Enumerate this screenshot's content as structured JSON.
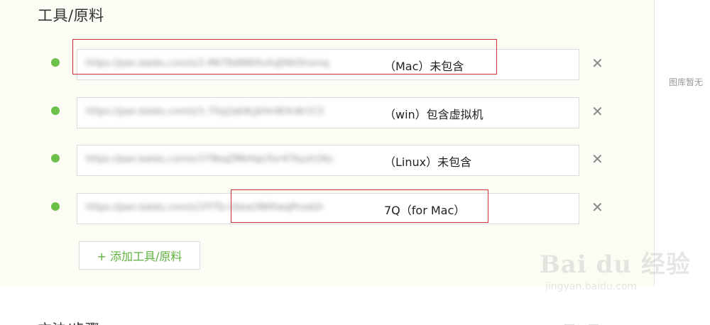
{
  "section": {
    "title": "工具/原料"
  },
  "tools": [
    {
      "url": "https://pan.baidu.com/s/1-MkT8dNWXvXqD6k5hxmq",
      "suffix": "（Mac）未包含"
    },
    {
      "url": "https://pan.baidu.com/s/1-7Xq2ab9LJkHnW3n8r1C2",
      "suffix": "（win）包含虚拟机"
    },
    {
      "url": "https://pan.baidu.com/s/1Y9bqZMkHqU3vr47bysh1Ku",
      "suffix": "（Linux）未包含"
    },
    {
      "url": "https://pan.baidu.com/s/1fYTb-Ubkw3NHtwqPnsdzh",
      "suffix": "7Q（for Mac）"
    }
  ],
  "remove_glyph": "✕",
  "add_button_label": "+ 添加工具/原料",
  "gutter_text": "图库暂无",
  "bottom_section_title": "方法/步骤",
  "watermark": {
    "main": "Bai du 经验",
    "sub": "jingyan.baidu.com"
  },
  "colors": {
    "accent_green": "#6cc04a",
    "annotation_red": "#c8343a",
    "panel_bg": "#fcfcf4"
  }
}
